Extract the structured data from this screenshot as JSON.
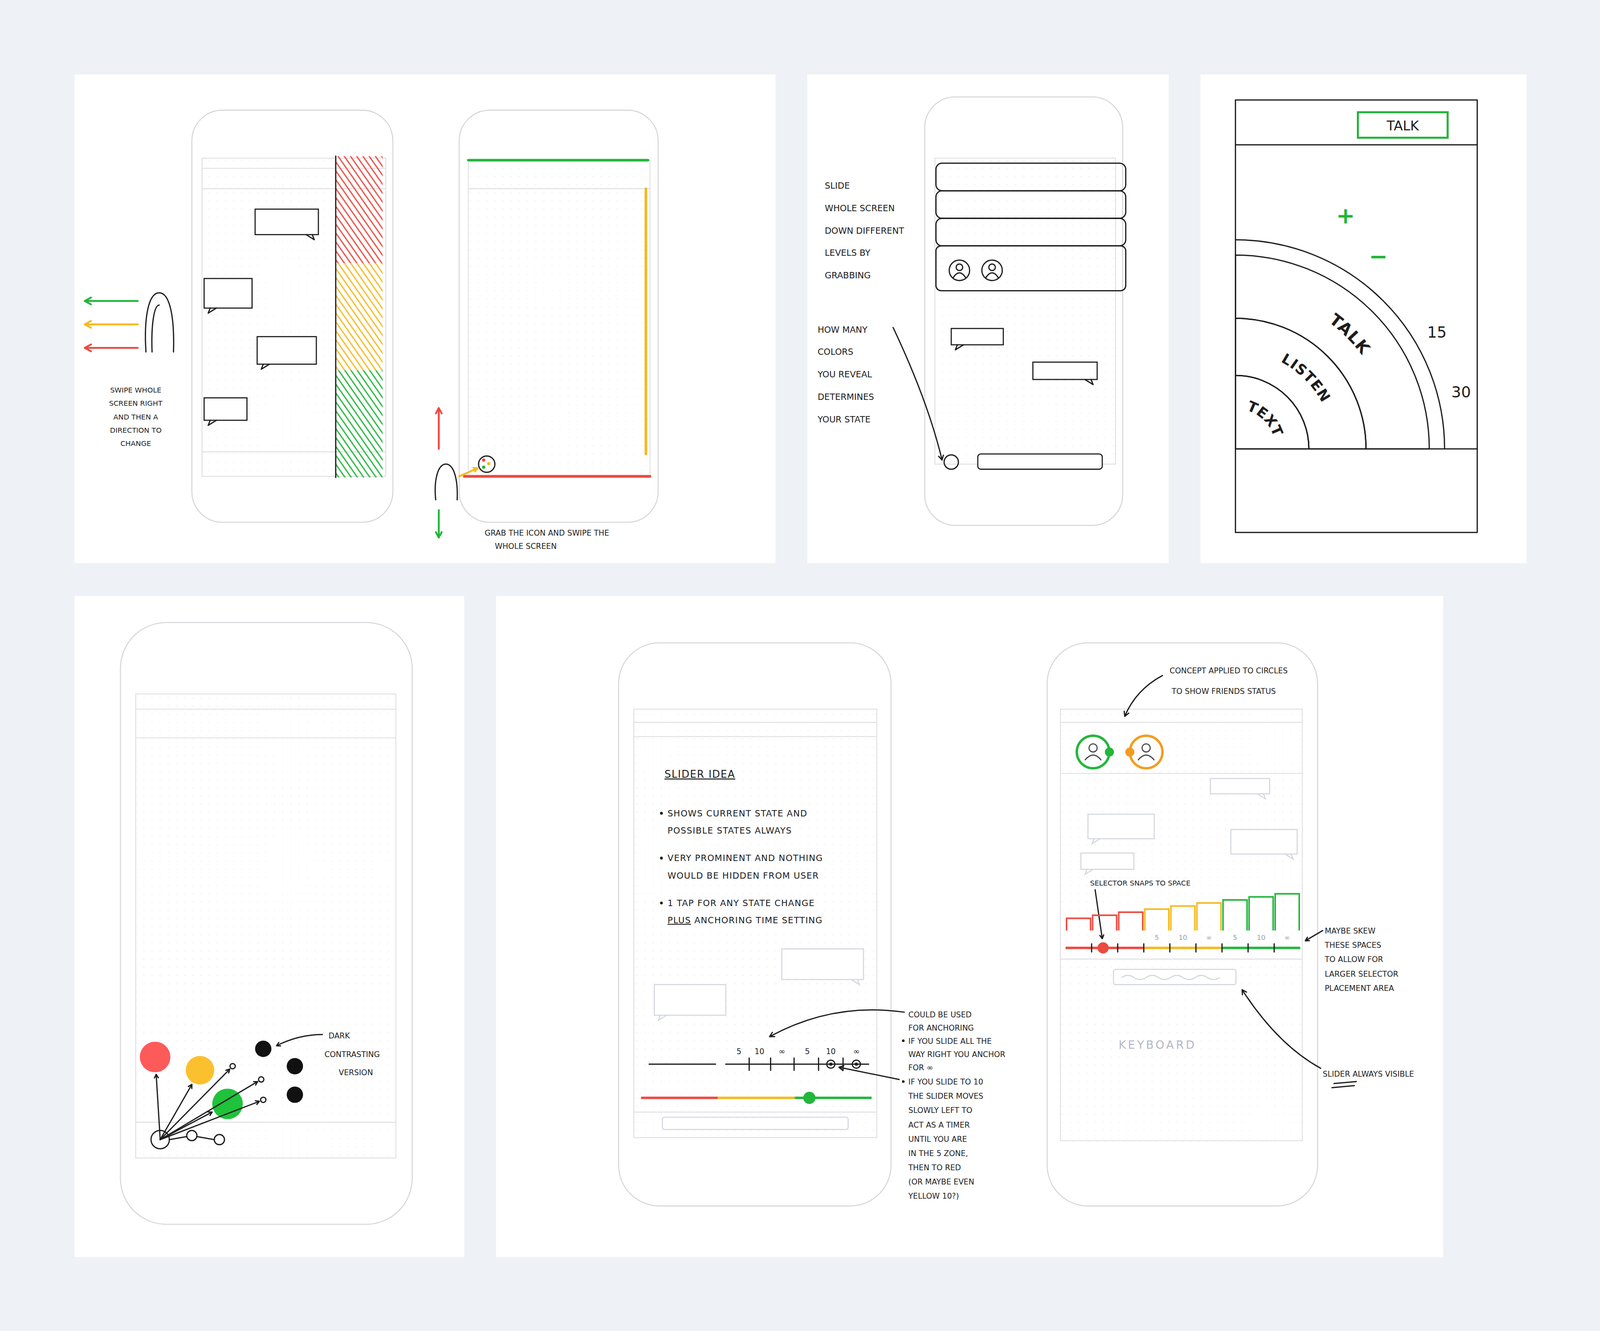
{
  "swipe_panel": {
    "arrows": [
      {
        "color": "#22b63a"
      },
      {
        "color": "#f6b91d"
      },
      {
        "color": "#ec4a40"
      }
    ],
    "side_bars": [
      {
        "color": "#ec4a40"
      },
      {
        "color": "#f6b91d"
      },
      {
        "color": "#22b63a"
      }
    ],
    "note": [
      "SWIPE WHOLE",
      "SCREEN RIGHT",
      "AND THEN A",
      "DIRECTION TO",
      "CHANGE"
    ],
    "edge_bars": [
      {
        "kind": "top",
        "color": "#22b63a"
      },
      {
        "kind": "right",
        "color": "#f6b91d"
      },
      {
        "kind": "bottom",
        "color": "#ec4a40"
      }
    ],
    "vertical_arrows": [
      {
        "kind": "up",
        "color": "#ec4a40"
      },
      {
        "kind": "down",
        "color": "#22b63a"
      }
    ],
    "grab_note": [
      "GRAB THE ICON AND SWIPE THE",
      "WHOLE SCREEN"
    ]
  },
  "reveal_panel": {
    "layers": [
      {
        "color": "#ec4a40"
      },
      {
        "color": "#f6b91d"
      },
      {
        "color": "#22b63a"
      }
    ],
    "slide_note": [
      "SLIDE",
      "WHOLE SCREEN",
      "DOWN DIFFERENT",
      "LEVELS BY",
      "GRABBING"
    ],
    "colors_note": [
      "HOW MANY",
      "COLORS",
      "YOU REVEAL",
      "DETERMINES",
      "YOUR STATE"
    ]
  },
  "dial_panel": {
    "button": "TALK",
    "plus": "+",
    "minus": "−",
    "rings": [
      {
        "label": "TALK",
        "color": "#22b63a"
      },
      {
        "label": "LISTEN",
        "color": "#f39c1f"
      },
      {
        "label": "TEXT",
        "color": "#ec4a40"
      }
    ],
    "ticks": [
      "15",
      "30"
    ]
  },
  "dots_panel": {
    "dots": [
      {
        "color": "#fd5a5a"
      },
      {
        "color": "#fbc02d"
      },
      {
        "color": "#1fc23b"
      }
    ],
    "dark_dots": [
      {
        "color": "#111111"
      },
      {
        "color": "#111111"
      },
      {
        "color": "#111111"
      }
    ],
    "note": [
      "DARK",
      "CONTRASTING",
      "VERSION"
    ]
  },
  "slider_panel": {
    "title": "SLIDER IDEA",
    "bullets": [
      {
        "lines": [
          [
            {
              "text": "SHOWS CURRENT STATE AND",
              "underline": false
            }
          ],
          [
            {
              "text": "POSSIBLE STATES ALWAYS",
              "underline": false
            }
          ]
        ]
      },
      {
        "lines": [
          [
            {
              "text": "VERY PROMINENT AND NOTHING",
              "underline": false
            }
          ],
          [
            {
              "text": "WOULD BE HIDDEN FROM USER",
              "underline": false
            }
          ]
        ]
      },
      {
        "lines": [
          [
            {
              "text": "1 TAP FOR ANY STATE CHANGE",
              "underline": false
            }
          ],
          [
            {
              "text": "PLUS",
              "underline": true
            },
            {
              "text": " ANCHORING TIME SETTING",
              "underline": false
            }
          ]
        ]
      }
    ],
    "segments": [
      {
        "color": "#ec4a40"
      },
      {
        "color": "#f6b91d"
      },
      {
        "color": "#22b63a"
      }
    ],
    "ticks": [
      "5",
      "10",
      "∞",
      "5",
      "10",
      "∞"
    ],
    "level": 0.73,
    "anchor_note": [
      {
        "text": "COULD BE USED",
        "bullet": false
      },
      {
        "text": "FOR ANCHORING",
        "bullet": false
      },
      {
        "text": "IF YOU SLIDE ALL THE",
        "bullet": true
      },
      {
        "text": "WAY RIGHT YOU ANCHOR",
        "bullet": false
      },
      {
        "text": "FOR ∞",
        "bullet": false
      }
    ],
    "timer_note": [
      {
        "text": "IF YOU SLIDE TO 10",
        "bullet": true
      },
      {
        "text": "THE SLIDER MOVES",
        "bullet": false
      },
      {
        "text": "SLOWLY LEFT TO",
        "bullet": false
      },
      {
        "text": "ACT AS A TIMER",
        "bullet": false
      },
      {
        "text": "UNTIL YOU ARE",
        "bullet": false
      },
      {
        "text": "IN THE 5 ZONE,",
        "bullet": false
      },
      {
        "text": "THEN TO RED",
        "bullet": false
      },
      {
        "text": "(OR MAYBE EVEN",
        "bullet": false
      },
      {
        "text": "YELLOW 10?)",
        "bullet": false
      }
    ]
  },
  "friends_panel": {
    "note": [
      "CONCEPT APPLIED TO CIRCLES",
      "TO SHOW FRIENDS STATUS"
    ],
    "friends": [
      {
        "color": "#22b63a"
      },
      {
        "color": "#f39c1f"
      }
    ],
    "snap_note": "SELECTOR SNAPS TO SPACE",
    "segments": [
      {
        "color": "#ec4a40"
      },
      {
        "color": "#f6b91d"
      },
      {
        "color": "#22b63a"
      }
    ],
    "ticks": [
      "5",
      "10",
      "∞",
      "5",
      "10",
      "∞"
    ],
    "level": 0.16,
    "skew_note": [
      "MAYBE SKEW",
      "THESE SPACES",
      "TO ALLOW FOR",
      "LARGER SELECTOR",
      "PLACEMENT AREA"
    ],
    "keyboard": "KEYBOARD",
    "visible_note": "SLIDER ALWAYS VISIBLE"
  }
}
